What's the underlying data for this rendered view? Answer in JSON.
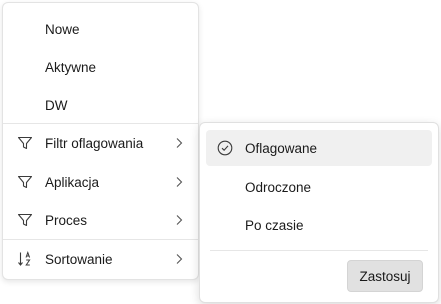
{
  "menu": {
    "items": [
      {
        "label": "Nowe",
        "icon": "none",
        "has_submenu": false
      },
      {
        "label": "Aktywne",
        "icon": "none",
        "has_submenu": false
      },
      {
        "label": "DW",
        "icon": "none",
        "has_submenu": false
      },
      {
        "label": "Filtr oflagowania",
        "icon": "filter-icon",
        "has_submenu": true
      },
      {
        "label": "Aplikacja",
        "icon": "filter-icon",
        "has_submenu": true
      },
      {
        "label": "Proces",
        "icon": "filter-icon",
        "has_submenu": true
      },
      {
        "label": "Sortowanie",
        "icon": "sort-icon",
        "has_submenu": true
      }
    ]
  },
  "submenu": {
    "items": [
      {
        "label": "Oflagowane",
        "checked": true
      },
      {
        "label": "Odroczone",
        "checked": false
      },
      {
        "label": "Po czasie",
        "checked": false
      }
    ],
    "apply_label": "Zastosuj"
  },
  "colors": {
    "text": "#1a1a1a",
    "icon": "#3b3b3b",
    "selected_bg": "#f0f0f0",
    "button_bg": "#e1e1e1"
  }
}
